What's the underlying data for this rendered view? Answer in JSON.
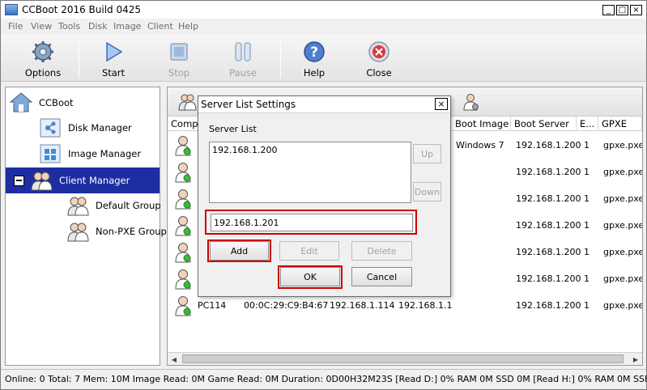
{
  "window": {
    "title": "CCBoot 2016 Build 0425",
    "controls": [
      "_",
      "□",
      "×"
    ]
  },
  "menu": [
    "File",
    "View",
    "Tools",
    "Disk",
    "Image",
    "Client",
    "Help"
  ],
  "toolbar": [
    {
      "label": "Options",
      "icon": "gear-icon",
      "enabled": true
    },
    {
      "label": "Start",
      "icon": "play-icon",
      "enabled": true
    },
    {
      "label": "Stop",
      "icon": "stop-icon",
      "enabled": false
    },
    {
      "label": "Pause",
      "icon": "pause-icon",
      "enabled": false
    },
    {
      "label": "Help",
      "icon": "help-icon",
      "enabled": true
    },
    {
      "label": "Close",
      "icon": "close-icon",
      "enabled": true
    }
  ],
  "tree": {
    "root": "CCBoot",
    "items": [
      "Disk Manager",
      "Image Manager",
      "Client Manager",
      "Default Group",
      "Non-PXE Group"
    ],
    "selected": "Client Manager"
  },
  "table": {
    "columns": [
      "Compu",
      "Boot Image",
      "Boot Server",
      "E...",
      "GPXE"
    ],
    "rows": [
      {
        "boot_image": "Windows 7",
        "boot_server": "192.168.1.200",
        "e": "1",
        "gpxe": "gpxe.pxe"
      },
      {
        "boot_image": "",
        "boot_server": "192.168.1.200",
        "e": "1",
        "gpxe": "gpxe.pxe"
      },
      {
        "boot_image": "",
        "boot_server": "192.168.1.200",
        "e": "1",
        "gpxe": "gpxe.pxe"
      },
      {
        "boot_image": "",
        "boot_server": "192.168.1.200",
        "e": "1",
        "gpxe": "gpxe.pxe"
      },
      {
        "boot_image": "",
        "boot_server": "192.168.1.200",
        "e": "1",
        "gpxe": "gpxe.pxe"
      },
      {
        "boot_image": "",
        "boot_server": "192.168.1.200",
        "e": "1",
        "gpxe": "gpxe.pxe"
      },
      {
        "name": "PC114",
        "mac": "00:0C:29:C9:B4:67",
        "ip": "192.168.1.114",
        "gateway": "192.168.1.1",
        "boot_image": "",
        "boot_server": "192.168.1.200",
        "e": "1",
        "gpxe": "gpxe.pxe"
      }
    ]
  },
  "status": "Online: 0 Total: 7 Mem: 10M Image Read: 0M Game Read: 0M Duration: 0D00H32M23S [Read D:] 0% RAM 0M SSD 0M [Read H:] 0% RAM 0M SSD 0M [Write F:]",
  "dialog": {
    "title": "Server List Settings",
    "close": "×",
    "list_label": "Server List",
    "list_items": [
      "192.168.1.200"
    ],
    "up": "Up",
    "down": "Down",
    "input_value": "192.168.1.201",
    "add": "Add",
    "edit": "Edit",
    "delete": "Delete",
    "ok": "OK",
    "cancel": "Cancel"
  },
  "colors": {
    "selection": "#1c2ea1",
    "highlight": "#cc0000"
  }
}
